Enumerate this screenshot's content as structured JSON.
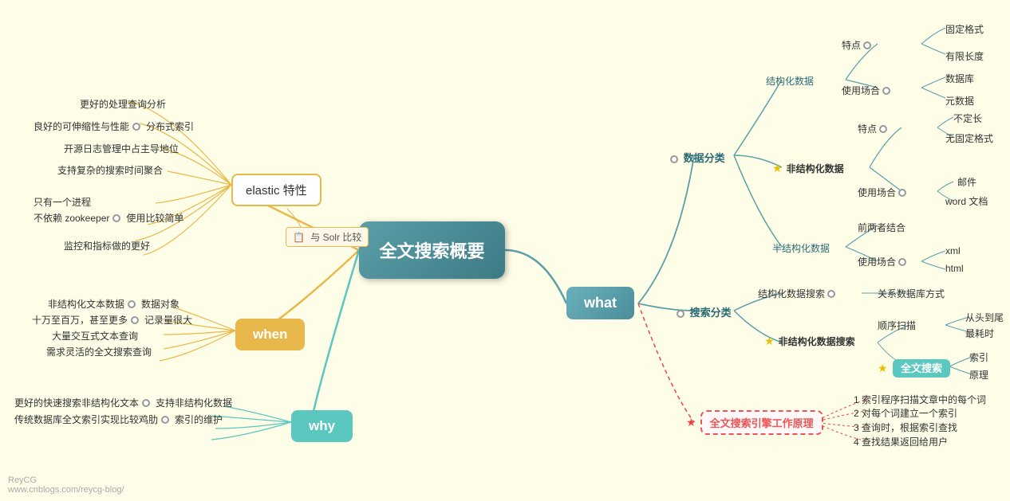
{
  "title": "全文搜索概要",
  "central": "全文搜索概要",
  "nodes": {
    "what": "what",
    "elastic": "elastic 特性",
    "when": "when",
    "why": "why",
    "solr": "与 Solr 比较",
    "fulltext": "全文搜索",
    "fulltext_principle": "全文搜索引擎工作原理"
  },
  "right_branches": {
    "data_classification": "数据分类",
    "search_classification": "搜索分类",
    "structured_data": "结构化数据",
    "unstructured_data": "非结构化数据",
    "semi_structured_data": "半结构化数据",
    "structured_features": "特点",
    "structured_features_1": "固定格式",
    "structured_features_2": "有限长度",
    "structured_use": "使用场合",
    "structured_use_1": "数据库",
    "structured_use_2": "元数据",
    "unstructured_features": "特点",
    "unstructured_f1": "不定长",
    "unstructured_f2": "无固定格式",
    "unstructured_use": "使用场合",
    "unstructured_u1": "邮件",
    "unstructured_u2": "word 文档",
    "semi_combine": "前两者结合",
    "semi_use": "使用场合",
    "semi_xml": "xml",
    "semi_html": "html",
    "structured_search": "结构化数据搜索",
    "structured_search_way": "关系数据库方式",
    "unstructured_search": "非结构化数据搜索",
    "sequential_scan": "顺序扫描",
    "seq_1": "从头到尾",
    "seq_2": "最耗时",
    "index_search": "索引",
    "index_reason": "原理",
    "principle_1": "1 索引程序扫描文章中的每个词",
    "principle_2": "2 对每个词建立一个索引",
    "principle_3": "3 查询时，根据索引查找",
    "principle_4": "4 查找结果返回给用户"
  },
  "left_branches": {
    "better_process": "更好的处理查询分析",
    "scalability": "良好的可伸缩性与性能",
    "distributed_index": "分布式索引",
    "open_source_log": "开源日志管理中占主导地位",
    "complex_search": "支持复杂的搜索时间聚合",
    "one_process": "只有一个进程",
    "no_zookeeper": "不依赖 zookeeper",
    "easy_use": "使用比较简单",
    "monitor": "监控和指标做的更好",
    "when_b1": "非结构化文本数据",
    "when_b2": "数据对象",
    "when_b3": "十万至百万，甚至更多",
    "when_b4": "记录量很大",
    "when_b5": "大量交互式文本查询",
    "when_b6": "需求灵活的全文搜索查询",
    "why_b1": "更好的快速搜索非结构化文本",
    "why_b2": "支持非结构化数据",
    "why_b3": "传统数据库全文索引实现比较鸡肋",
    "why_b4": "索引的维护"
  },
  "footer": {
    "line1": "ReyCG",
    "line2": "www.cnblogs.com/reycg-blog/"
  }
}
